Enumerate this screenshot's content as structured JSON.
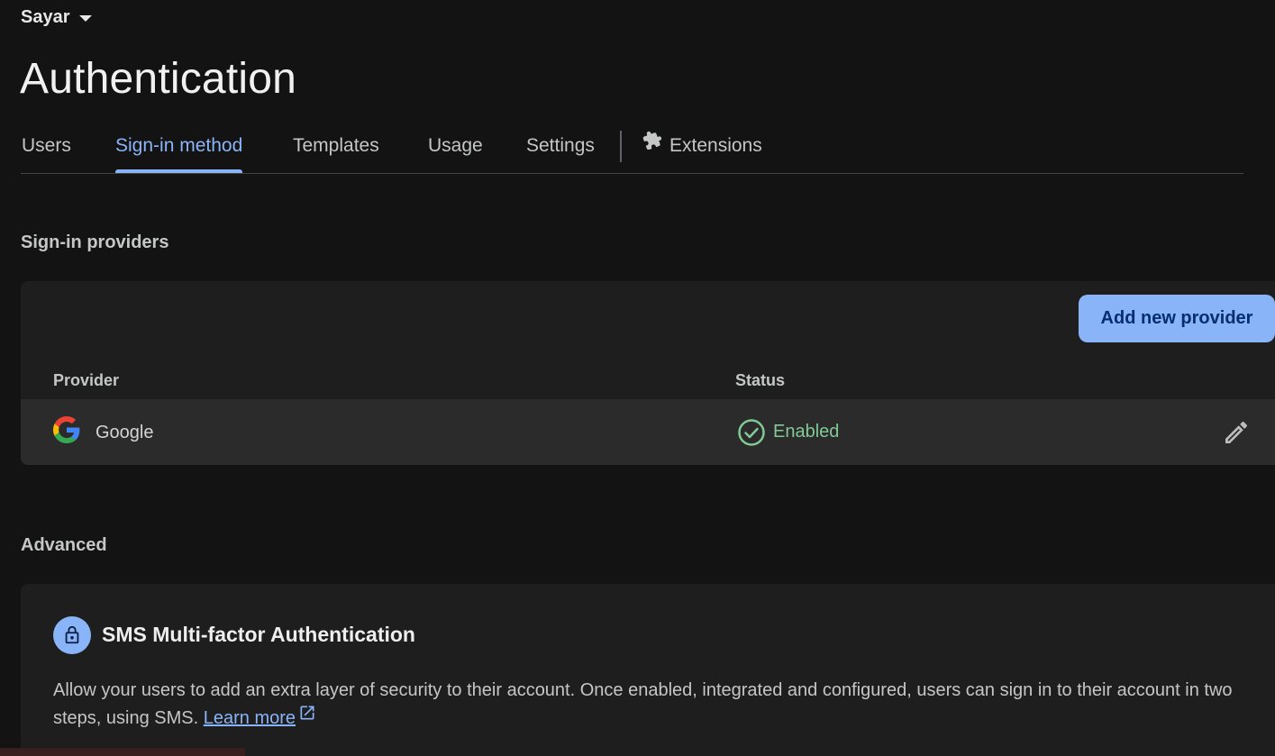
{
  "project": {
    "name": "Sayar"
  },
  "page": {
    "title": "Authentication"
  },
  "tabs": [
    {
      "label": "Users"
    },
    {
      "label": "Sign-in method",
      "active": true
    },
    {
      "label": "Templates"
    },
    {
      "label": "Usage"
    },
    {
      "label": "Settings"
    },
    {
      "label": "Extensions",
      "icon": "puzzle-icon"
    }
  ],
  "sign_in_providers": {
    "heading": "Sign-in providers",
    "add_button_label": "Add new provider",
    "columns": {
      "provider": "Provider",
      "status": "Status"
    },
    "rows": [
      {
        "provider": "Google",
        "icon": "google-logo-icon",
        "status": "Enabled",
        "status_icon": "check-circle-icon"
      }
    ]
  },
  "advanced": {
    "heading": "Advanced",
    "sms_mfa": {
      "icon": "lock-icon",
      "title": "SMS Multi-factor Authentication",
      "description": "Allow your users to add an extra layer of security to their account. Once enabled, integrated and configured, users can sign in to their account in two steps, using SMS.",
      "learn_more_label": "Learn more"
    }
  },
  "colors": {
    "background": "#131313",
    "card": "#1e1e1e",
    "accent": "#8ab4f8",
    "success": "#81c995"
  }
}
